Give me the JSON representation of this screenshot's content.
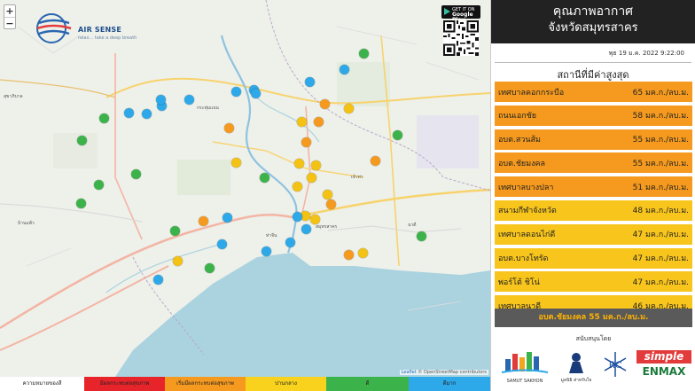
{
  "map": {
    "zoom_in": "+",
    "zoom_out": "−",
    "brand": "AIR SENSE",
    "brand_tagline": "relax... take a deep breath",
    "google_play_small": "GET IT ON",
    "google_play": "Google Play",
    "attribution_leaflet": "Leaflet",
    "attribution_osm": "© OpenStreetMap contributors",
    "places": [
      "สุขาภิบาล",
      "กระทุ่มแบน",
      "สมุทรสาคร",
      "บ้านแพ้ว",
      "นาดี",
      "เจ้าท่า",
      "ท่าจีน"
    ],
    "colors": {
      "blue": "#2da8e8",
      "green": "#3cb34a",
      "yellow": "#f3c212",
      "orange": "#f59a1e"
    }
  },
  "legend": {
    "label": "ความหมายของสี",
    "items": [
      {
        "label": "มีผลกระทบต่อสุขภาพ",
        "color": "#e8242b"
      },
      {
        "label": "เริ่มมีผลกระทบต่อสุขภาพ",
        "color": "#f59a1e"
      },
      {
        "label": "ปานกลาง",
        "color": "#f8d21c"
      },
      {
        "label": "ดี",
        "color": "#3cb34a"
      },
      {
        "label": "ดีมาก",
        "color": "#2da8e8"
      }
    ]
  },
  "panel": {
    "title_line1": "คุณภาพอากาศ",
    "title_line2": "จังหวัดสมุทรสาคร",
    "timestamp": "พุธ 19 ม.ค. 2022 9:22:00",
    "subtitle": "สถานีที่มีค่าสูงสุด",
    "rows": [
      {
        "name": "เทศบาลคอกกระบือ",
        "value": "65 มค.ก./ลบ.ม.",
        "color": "#f59a1e"
      },
      {
        "name": "ถนนเอกชัย",
        "value": "58 มค.ก./ลบ.ม.",
        "color": "#f59a1e"
      },
      {
        "name": "อบต.สวนส้ม",
        "value": "55 มค.ก./ลบ.ม.",
        "color": "#f59a1e"
      },
      {
        "name": "อบต.ชัยมงคล",
        "value": "55 มค.ก./ลบ.ม.",
        "color": "#f59a1e"
      },
      {
        "name": "เทศบาลบางปลา",
        "value": "51 มค.ก./ลบ.ม.",
        "color": "#f59a1e"
      },
      {
        "name": "สนามกีฬาจังหวัด",
        "value": "48 มค.ก./ลบ.ม.",
        "color": "#f8c51c"
      },
      {
        "name": "เทศบาลดอนไก่ดี",
        "value": "47 มค.ก./ลบ.ม.",
        "color": "#f8c51c"
      },
      {
        "name": "อบต.บางโทรัด",
        "value": "47 มค.ก./ลบ.ม.",
        "color": "#f8c51c"
      },
      {
        "name": "พอร์โต้ ชิโน่",
        "value": "47 มค.ก./ลบ.ม.",
        "color": "#f8c51c"
      },
      {
        "name": "เทศบาลนาดี",
        "value": "46 มค.ก./ลบ.ม.",
        "color": "#f8c51c"
      }
    ],
    "summary": "อบต.ชัยมงคล 55 มค.ก./ลบ.ม.",
    "sponsor_title": "สนับสนุนโดย",
    "sponsors": [
      "SAMUT SAKHON",
      "มูลนิธิ ส่าหรับใจ",
      "RC",
      "simple",
      "ENMAX"
    ]
  }
}
